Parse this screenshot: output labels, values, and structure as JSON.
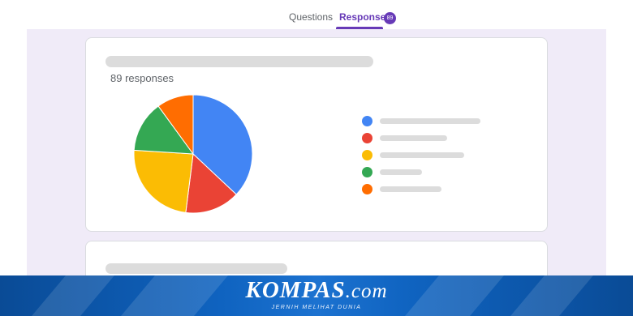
{
  "tabs": {
    "questions_label": "Questions",
    "responses_label": "Responses",
    "responses_badge": "89"
  },
  "card1": {
    "response_count": "89 responses",
    "legend": [
      {
        "color": "#4285f4"
      },
      {
        "color": "#ea4335"
      },
      {
        "color": "#fbbc04"
      },
      {
        "color": "#34a853"
      },
      {
        "color": "#ff6d01"
      }
    ]
  },
  "chart_data": {
    "type": "pie",
    "title": "",
    "slices": [
      {
        "color": "#4285f4",
        "value": 37
      },
      {
        "color": "#ea4335",
        "value": 15
      },
      {
        "color": "#fbbc04",
        "value": 24
      },
      {
        "color": "#34a853",
        "value": 14
      },
      {
        "color": "#ff6d01",
        "value": 10
      }
    ],
    "legend_position": "right"
  },
  "footer": {
    "brand_main": "KOMPAS",
    "brand_suffix": ".com",
    "tagline": "JERNIH MELIHAT DUNIA"
  }
}
